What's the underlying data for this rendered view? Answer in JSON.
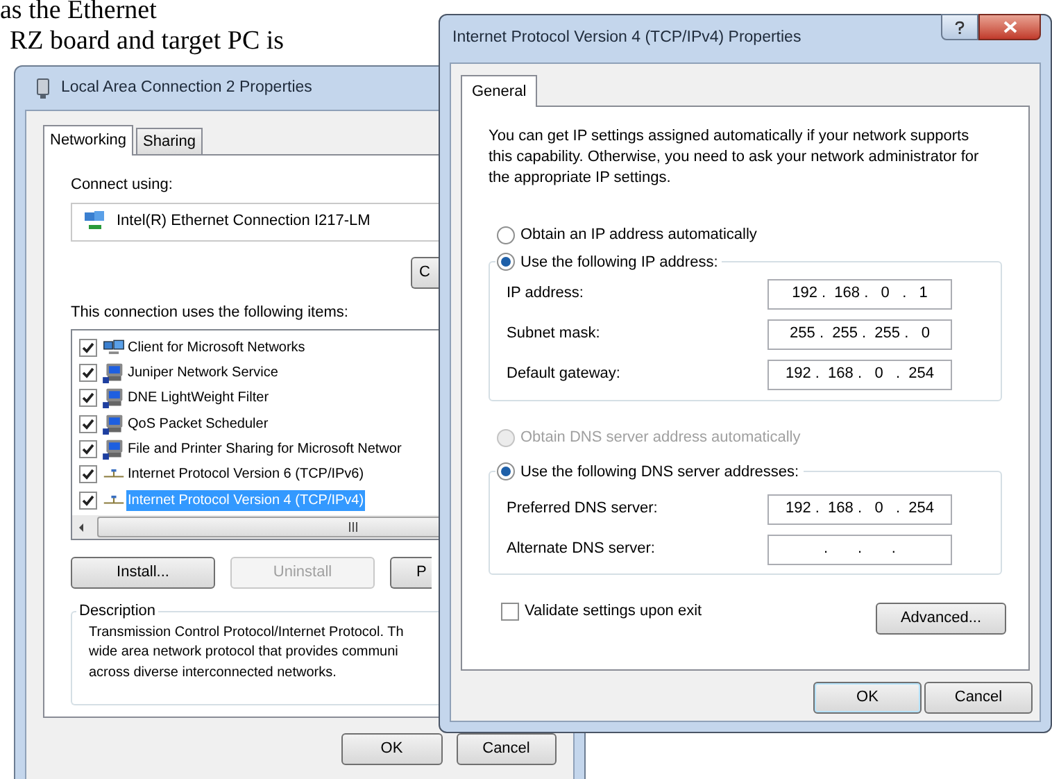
{
  "document_text": [
    "as the Ethernet",
    "RZ board and target PC is"
  ],
  "left_window": {
    "title": "Local Area Connection 2 Properties",
    "tabs": [
      {
        "label": "Networking",
        "selected": true
      },
      {
        "label": "Sharing",
        "selected": false
      }
    ],
    "connect_using_label": "Connect using:",
    "adapter": "Intel(R) Ethernet Connection I217-LM",
    "configure_button": "C",
    "items_label": "This connection uses the following items:",
    "items": [
      {
        "label": "Client for Microsoft Networks",
        "kind": "client",
        "checked": true,
        "selected": false
      },
      {
        "label": "Juniper Network Service",
        "kind": "service",
        "checked": true,
        "selected": false
      },
      {
        "label": "DNE LightWeight Filter",
        "kind": "service",
        "checked": true,
        "selected": false
      },
      {
        "label": "QoS Packet Scheduler",
        "kind": "service",
        "checked": true,
        "selected": false
      },
      {
        "label": "File and Printer Sharing for Microsoft Networ",
        "kind": "service",
        "checked": true,
        "selected": false
      },
      {
        "label": "Internet Protocol Version 6 (TCP/IPv6)",
        "kind": "protocol",
        "checked": true,
        "selected": false
      },
      {
        "label": "Internet Protocol Version 4 (TCP/IPv4)",
        "kind": "protocol",
        "checked": true,
        "selected": true
      }
    ],
    "buttons": [
      {
        "label": "Install...",
        "disabled": false
      },
      {
        "label": "Uninstall",
        "disabled": true
      },
      {
        "label": "P",
        "disabled": false
      }
    ],
    "description": {
      "title": "Description",
      "lines": [
        "Transmission Control Protocol/Internet Protocol. Th",
        "wide area network protocol that provides communi",
        "across diverse interconnected networks."
      ]
    },
    "footer_buttons": [
      "OK",
      "Cancel"
    ]
  },
  "right_window": {
    "title": "Internet Protocol Version 4 (TCP/IPv4) Properties",
    "tabs": [
      {
        "label": "General",
        "selected": true
      }
    ],
    "intro": "You can get IP settings assigned automatically if your network supports this capability. Otherwise, you need to ask your network administrator for the appropriate IP settings.",
    "ip_options": [
      {
        "label": "Obtain an IP address automatically",
        "selected": false,
        "disabled": false
      },
      {
        "label": "Use the following IP address:",
        "selected": true,
        "disabled": false
      }
    ],
    "ip_fields": [
      {
        "label": "IP address:",
        "value": "192 .  168 .   0   .   1"
      },
      {
        "label": "Subnet mask:",
        "value": "255 .  255 .  255 .   0"
      },
      {
        "label": "Default gateway:",
        "value": "192 .  168 .   0   .  254"
      }
    ],
    "dns_options": [
      {
        "label": "Obtain DNS server address automatically",
        "selected": false,
        "disabled": true
      },
      {
        "label": "Use the following DNS server addresses:",
        "selected": true,
        "disabled": false
      }
    ],
    "dns_fields": [
      {
        "label": "Preferred DNS server:",
        "value": "192 .  168 .   0   .  254"
      },
      {
        "label": "Alternate DNS server:",
        "value": ".       .       ."
      }
    ],
    "validate": {
      "label": "Validate settings upon exit",
      "checked": false
    },
    "advanced_button": "Advanced...",
    "footer_buttons": [
      "OK",
      "Cancel"
    ]
  }
}
